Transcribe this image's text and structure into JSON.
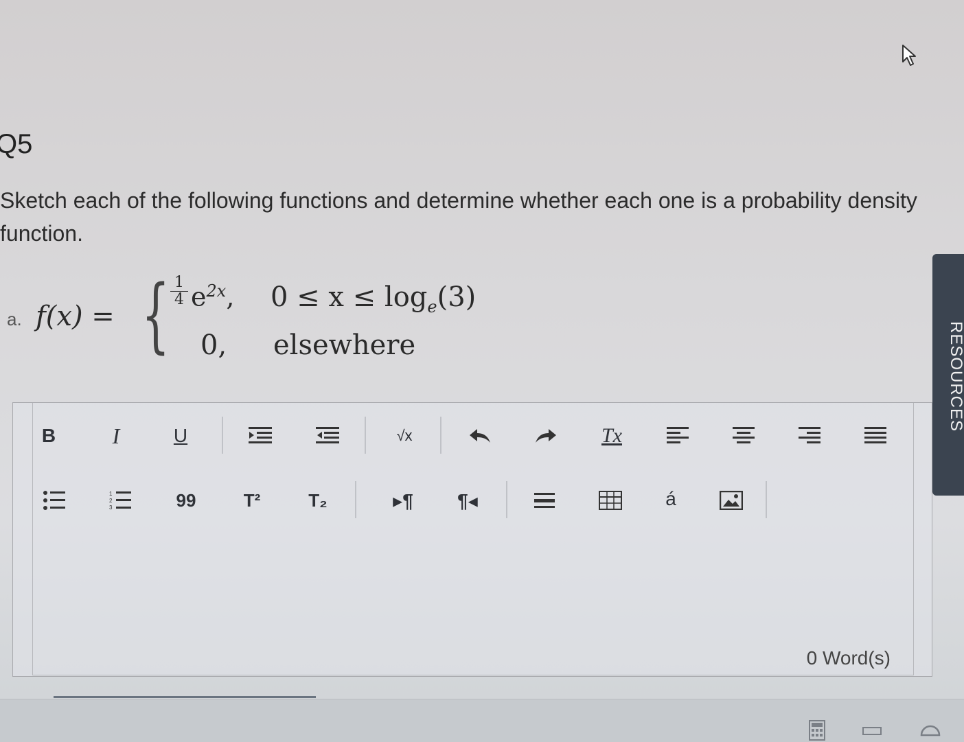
{
  "question": {
    "number": "Q5",
    "prompt": "Sketch each of the following functions and determine whether each one is a probability density function."
  },
  "part_a": {
    "label": "a.",
    "function": "f(x) =",
    "equals": "=",
    "case1_expr_num": "1",
    "case1_expr_den": "4",
    "case1_exp_base": "e",
    "case1_exp_power": "2x",
    "case1_sep": ",",
    "case1_condition": "0 ≤ x ≤ log",
    "case1_condition_sub": "e",
    "case1_condition_tail": "(3)",
    "case2_expr": "0,",
    "case2_condition": "elsewhere"
  },
  "editor": {
    "toolbar_row1": [
      "bold",
      "italic",
      "underline",
      "indent",
      "outdent",
      "sqrt",
      "undo",
      "redo",
      "clear-format",
      "align-left",
      "align-center",
      "align-right",
      "justify"
    ],
    "toolbar_row2": [
      "bulleted-list",
      "numbered-list",
      "blockquote",
      "superscript",
      "subscript",
      "ltr",
      "rtl",
      "horizontal-rule",
      "table",
      "special-char",
      "image"
    ],
    "labels": {
      "bold": "B",
      "italic": "I",
      "underline": "U",
      "sqrt": "√x",
      "clear": "Tx",
      "quote": "99",
      "sup": "T²",
      "sub": "T₂",
      "ltr": "▸¶",
      "rtl": "¶◂",
      "special": "á"
    },
    "word_count": "0 Word(s)"
  },
  "sidebar": {
    "resources_label": "RESOURCES"
  }
}
